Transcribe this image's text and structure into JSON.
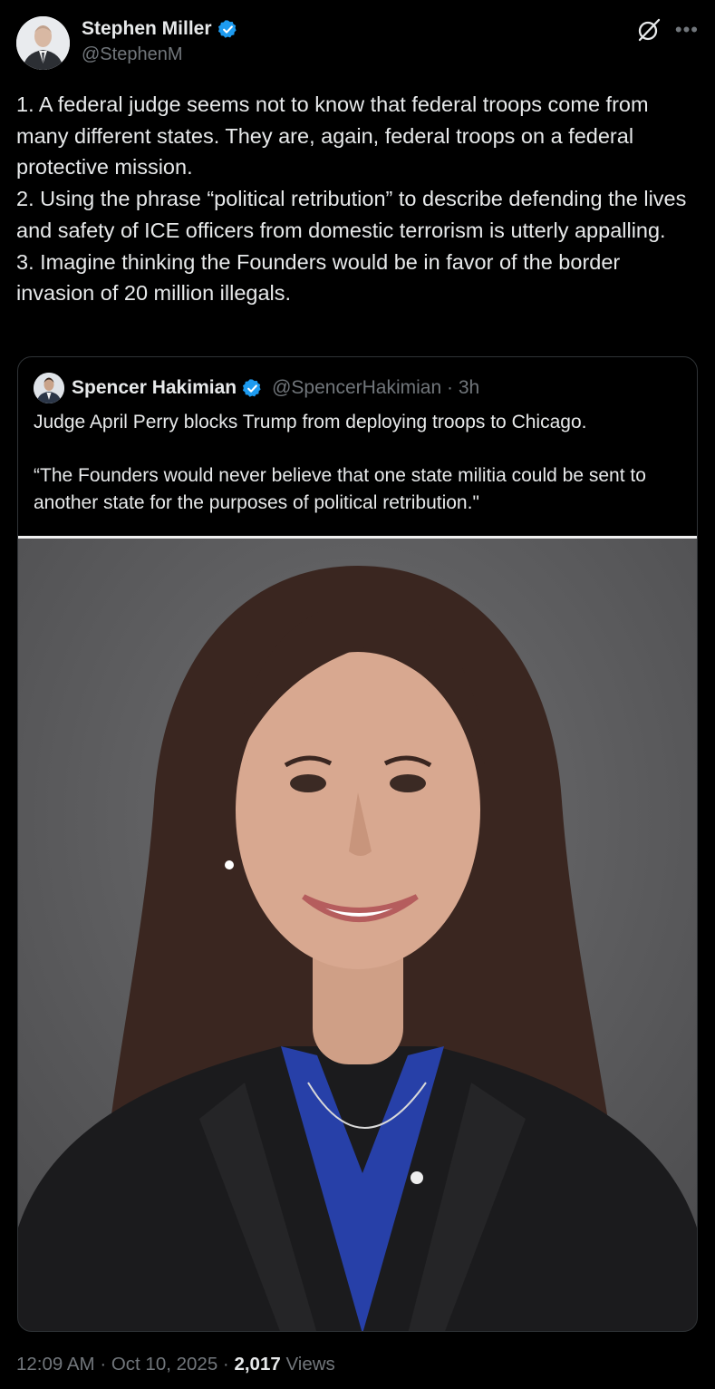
{
  "tweet": {
    "author": {
      "name": "Stephen Miller",
      "handle": "@StephenM"
    },
    "text": "1. A federal judge seems not to know that federal troops come from many different states. They are, again, federal troops on a federal protective mission.\n2. Using the phrase “political retribution” to describe defending the lives and safety of ICE officers from domestic terrorism is utterly appalling.\n3. Imagine thinking the Founders would be in favor of the border invasion of 20 million illegals.",
    "time": "12:09 AM",
    "date": "Oct 10, 2025",
    "views_count": "2,017",
    "views_label": "Views"
  },
  "quote": {
    "author": {
      "name": "Spencer Hakimian",
      "handle": "@SpencerHakimian"
    },
    "age": "3h",
    "text": "Judge April Perry blocks Trump from deploying troops to Chicago.\n\n“The Founders would never believe that one state militia could be sent to another state for the purposes of political retribution.\""
  },
  "icons": {
    "verified": "verified-badge-icon",
    "grok": "grok-icon",
    "more": "more-icon"
  },
  "colors": {
    "background": "#000000",
    "text": "#e7e9ea",
    "muted": "#71767b",
    "verified": "#1d9bf0",
    "border": "#2f3336"
  }
}
